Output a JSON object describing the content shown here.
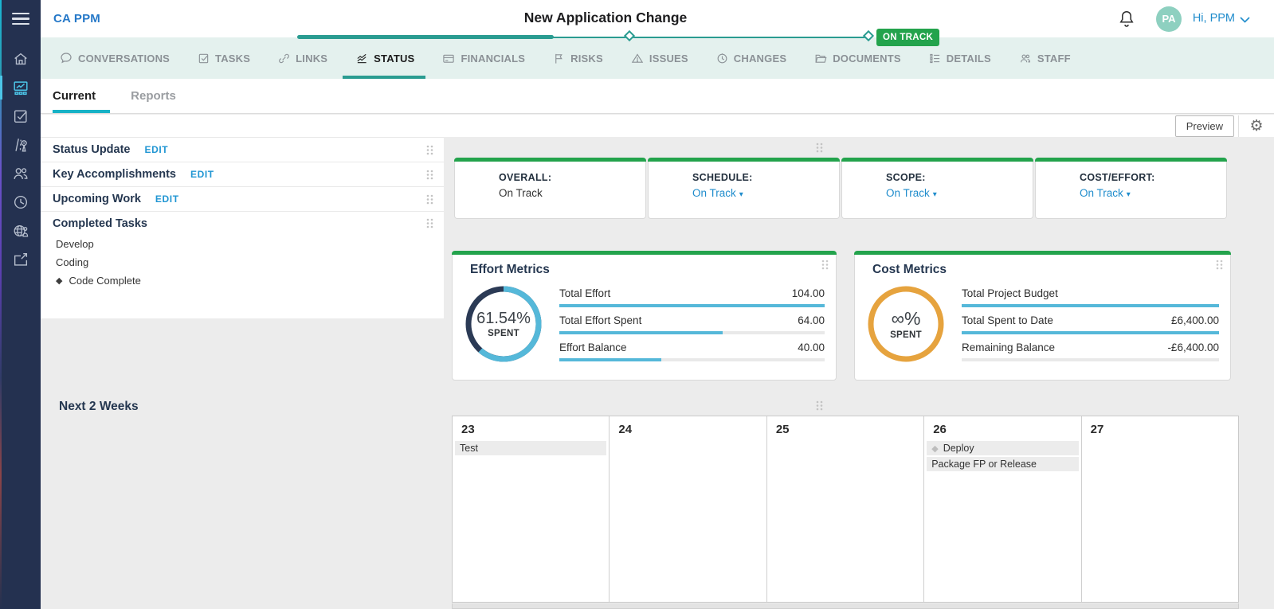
{
  "colors": {
    "accent_teal": "#2a9c91",
    "accent_cyan": "#17b2c6",
    "status_green": "#23a34c",
    "link_blue": "#1f8ccc",
    "brand_blue": "#2578c8",
    "bar_blue": "#55b8d9",
    "gauge_navy": "#2b3a55",
    "gauge_orange": "#e6a33e",
    "sidebar_navy": "#243150",
    "tabbar_mint": "#e4f1ee"
  },
  "header": {
    "brand": "CA PPM",
    "title": "New Application Change",
    "status_badge": "ON TRACK",
    "greeting": "Hi, PPM",
    "avatar_initials": "PA"
  },
  "sidebar": {
    "items": [
      {
        "name": "home"
      },
      {
        "name": "status-dashboard",
        "active": true
      },
      {
        "name": "tasks"
      },
      {
        "name": "roadmap"
      },
      {
        "name": "people"
      },
      {
        "name": "timesheets"
      },
      {
        "name": "global"
      },
      {
        "name": "export"
      }
    ]
  },
  "tabs": [
    {
      "label": "CONVERSATIONS",
      "icon": "speech-bubble"
    },
    {
      "label": "TASKS",
      "icon": "checkbox"
    },
    {
      "label": "LINKS",
      "icon": "link"
    },
    {
      "label": "STATUS",
      "icon": "status-chart",
      "active": true
    },
    {
      "label": "FINANCIALS",
      "icon": "card"
    },
    {
      "label": "RISKS",
      "icon": "flag"
    },
    {
      "label": "ISSUES",
      "icon": "warning-triangle"
    },
    {
      "label": "CHANGES",
      "icon": "clock-history"
    },
    {
      "label": "DOCUMENTS",
      "icon": "folder"
    },
    {
      "label": "DETAILS",
      "icon": "list"
    },
    {
      "label": "STAFF",
      "icon": "people"
    }
  ],
  "subtabs": [
    {
      "label": "Current",
      "active": true
    },
    {
      "label": "Reports",
      "active": false
    }
  ],
  "toolbar": {
    "preview_label": "Preview"
  },
  "left_panel": {
    "sections": [
      {
        "title": "Status Update",
        "edit_label": "EDIT"
      },
      {
        "title": "Key Accomplishments",
        "edit_label": "EDIT"
      },
      {
        "title": "Upcoming Work",
        "edit_label": "EDIT"
      },
      {
        "title": "Completed Tasks",
        "items": [
          {
            "label": "Develop",
            "milestone": false
          },
          {
            "label": "Coding",
            "milestone": false
          },
          {
            "label": "Code Complete",
            "milestone": true
          }
        ]
      }
    ]
  },
  "status_cards": [
    {
      "label": "OVERALL:",
      "value": "On Track",
      "dropdown": false
    },
    {
      "label": "SCHEDULE:",
      "value": "On Track",
      "dropdown": true
    },
    {
      "label": "SCOPE:",
      "value": "On Track",
      "dropdown": true
    },
    {
      "label": "COST/EFFORT:",
      "value": "On Track",
      "dropdown": true
    }
  ],
  "effort_metrics": {
    "title": "Effort Metrics",
    "gauge_percent": 61.54,
    "gauge_value": "61.54%",
    "gauge_label": "SPENT",
    "rows": [
      {
        "label": "Total Effort",
        "value": "104.00",
        "percent": 100
      },
      {
        "label": "Total Effort Spent",
        "value": "64.00",
        "percent": 61.5
      },
      {
        "label": "Effort Balance",
        "value": "40.00",
        "percent": 38.5
      }
    ]
  },
  "cost_metrics": {
    "title": "Cost Metrics",
    "gauge_value": "∞%",
    "gauge_label": "SPENT",
    "rows": [
      {
        "label": "Total Project Budget",
        "value": "",
        "percent": 100
      },
      {
        "label": "Total Spent to Date",
        "value": "£6,400.00",
        "percent": 100
      },
      {
        "label": "Remaining Balance",
        "value": "-£6,400.00",
        "percent": 0
      }
    ]
  },
  "calendar": {
    "title": "Next 2 Weeks",
    "days": [
      {
        "day": "23",
        "events": [
          {
            "label": "Test",
            "milestone": false
          }
        ]
      },
      {
        "day": "24",
        "events": []
      },
      {
        "day": "25",
        "events": []
      },
      {
        "day": "26",
        "events": [
          {
            "label": "Deploy",
            "milestone": true
          },
          {
            "label": "Package FP or Release",
            "milestone": false
          }
        ]
      },
      {
        "day": "27",
        "events": []
      }
    ]
  }
}
